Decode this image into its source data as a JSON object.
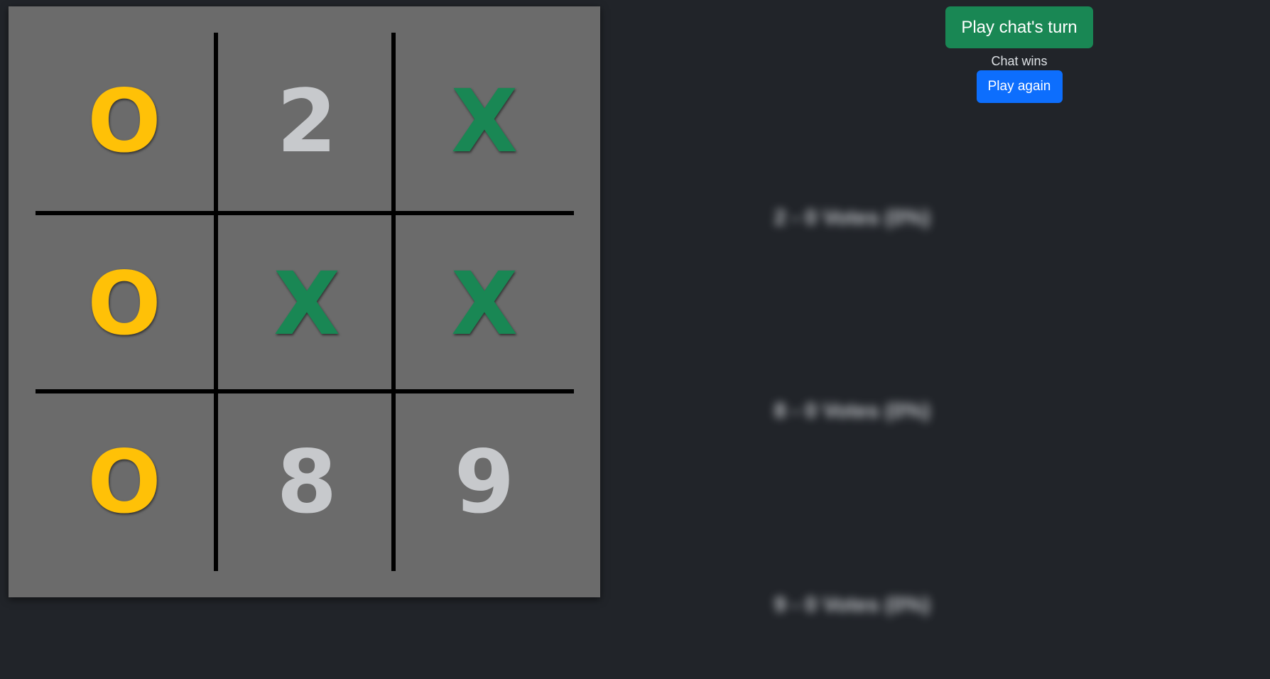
{
  "board": {
    "cells": [
      {
        "label": "O",
        "kind": "o"
      },
      {
        "label": "2",
        "kind": "num"
      },
      {
        "label": "X",
        "kind": "x"
      },
      {
        "label": "O",
        "kind": "o"
      },
      {
        "label": "X",
        "kind": "x"
      },
      {
        "label": "X",
        "kind": "x"
      },
      {
        "label": "O",
        "kind": "o"
      },
      {
        "label": "8",
        "kind": "num"
      },
      {
        "label": "9",
        "kind": "num"
      }
    ]
  },
  "controls": {
    "play_chat_turn_label": "Play chat's turn",
    "status_text": "Chat wins",
    "play_again_label": "Play again"
  },
  "colors": {
    "background": "#212429",
    "board": "#6b6b6b",
    "o_mark": "#ffc107",
    "x_mark": "#198754",
    "chat_button": "#198754",
    "again_button": "#0d6efd"
  },
  "blurred_entries": [
    "2 - 0 Votes (0%)",
    "8 - 0 Votes (0%)",
    "9 - 0 Votes (0%)"
  ]
}
